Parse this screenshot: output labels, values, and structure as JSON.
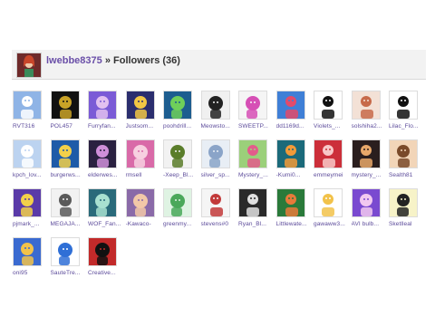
{
  "header": {
    "username": "lwebbe8375",
    "separator": " » ",
    "section": "Followers (36)"
  },
  "followers": [
    {
      "name": "RVT316",
      "bg": "#8fb4e6",
      "fg": "#ffffff",
      "icon": "white-cat-icon"
    },
    {
      "name": "POL457",
      "bg": "#111111",
      "fg": "#c9a227",
      "icon": "golden-robot-icon"
    },
    {
      "name": "Furryfan...",
      "bg": "#7b5bd6",
      "fg": "#e2c0f0",
      "icon": "fox-character-icon"
    },
    {
      "name": "Justsom...",
      "bg": "#2b2e6e",
      "fg": "#f2c744",
      "icon": "yellow-face-icon"
    },
    {
      "name": "poohdrill...",
      "bg": "#1d5d8f",
      "fg": "#6fcf5a",
      "icon": "game-art-icon"
    },
    {
      "name": "Meowsto...",
      "bg": "#f0f0f0",
      "fg": "#222222",
      "icon": "cat-icon"
    },
    {
      "name": "SWEETP...",
      "bg": "#f5f5f5",
      "fg": "#d64fb5",
      "icon": "pink-character-icon"
    },
    {
      "name": "dd1169d...",
      "bg": "#3f7fd6",
      "fg": "#e34a6a",
      "icon": "colorful-character-icon"
    },
    {
      "name": "Violets_...",
      "bg": "#ffffff",
      "fg": "#111111",
      "icon": "black-hair-character-icon"
    },
    {
      "name": "solshiha2...",
      "bg": "#f3e1d6",
      "fg": "#c76a4a",
      "icon": "anime-girl-icon"
    },
    {
      "name": "Lilac_Flo...",
      "bg": "#ffffff",
      "fg": "#111111",
      "icon": "among-us-icon"
    },
    {
      "name": "kpch_lov...",
      "bg": "#bcd3f0",
      "fg": "#ffffff",
      "icon": "white-cat-icon"
    },
    {
      "name": "burgerws...",
      "bg": "#1e5ba8",
      "fg": "#f2d04a",
      "icon": "abstract-art-icon"
    },
    {
      "name": "elderwes...",
      "bg": "#2a2140",
      "fg": "#cf8fd9",
      "icon": "dark-character-icon"
    },
    {
      "name": "rmsell",
      "bg": "#d96aa8",
      "fg": "#f7d0e0",
      "icon": "pink-girl-icon"
    },
    {
      "name": "-Xeep_Bl...",
      "bg": "#f2f2f2",
      "fg": "#5a7d2a",
      "icon": "sketch-character-icon"
    },
    {
      "name": "silver_sp...",
      "bg": "#e8eef5",
      "fg": "#8aa4c8",
      "icon": "tower-icon"
    },
    {
      "name": "Mystery_...",
      "bg": "#9bd07a",
      "fg": "#e35c8b",
      "icon": "colorful-character-icon"
    },
    {
      "name": "-Kumi0...",
      "bg": "#1b6a7a",
      "fg": "#f29a38",
      "icon": "orange-character-icon"
    },
    {
      "name": "emmeymei",
      "bg": "#cc2f3a",
      "fg": "#f8c8c8",
      "icon": "red-character-icon"
    },
    {
      "name": "mystery_...",
      "bg": "#2a1e1e",
      "fg": "#e8a86a",
      "icon": "dark-character-icon"
    },
    {
      "name": "Sealth81",
      "bg": "#f2d5b8",
      "fg": "#7a4a2a",
      "icon": "sketch-character-icon"
    },
    {
      "name": "pjmark_...",
      "bg": "#5a3aa8",
      "fg": "#f2d04a",
      "icon": "abstract-art-icon"
    },
    {
      "name": "MEGAJA...",
      "bg": "#f2f2f2",
      "fg": "#5a5a5a",
      "icon": "cat-icon"
    },
    {
      "name": "WOF_Fan...",
      "bg": "#2a6a7a",
      "fg": "#a8e0d0",
      "icon": "dragon-icon"
    },
    {
      "name": "-Kawaco-",
      "bg": "#8a6aa8",
      "fg": "#f2c8a8",
      "icon": "anime-girl-icon"
    },
    {
      "name": "greenmy...",
      "bg": "#dff3e3",
      "fg": "#4aa85a",
      "icon": "green-character-icon"
    },
    {
      "name": "stevens#0",
      "bg": "#f5f5f5",
      "fg": "#c23a3a",
      "icon": "sketch-character-icon"
    },
    {
      "name": "Ryan_Bl...",
      "bg": "#2a2a2a",
      "fg": "#e0e0e0",
      "icon": "dark-character-icon"
    },
    {
      "name": "Littlewate...",
      "bg": "#2a7a3a",
      "fg": "#e87a3a",
      "icon": "pumpkin-character-icon"
    },
    {
      "name": "gawaww3...",
      "bg": "#ffffff",
      "fg": "#f2c24a",
      "icon": "cheese-icon"
    },
    {
      "name": "AVI bulb...",
      "bg": "#7a4ad0",
      "fg": "#f2c8f0",
      "icon": "purple-character-icon"
    },
    {
      "name": "Sketlleal",
      "bg": "#f7f3c8",
      "fg": "#222222",
      "icon": "doodle-icon"
    },
    {
      "name": "oni95",
      "bg": "#3a6ad0",
      "fg": "#f2c24a",
      "icon": "abstract-art-icon"
    },
    {
      "name": "SauteTre...",
      "bg": "#ffffff",
      "fg": "#2f6fd6",
      "icon": "blue-diamond-icon"
    },
    {
      "name": "Creative...",
      "bg": "#c22a2a",
      "fg": "#111111",
      "icon": "red-character-icon"
    }
  ]
}
